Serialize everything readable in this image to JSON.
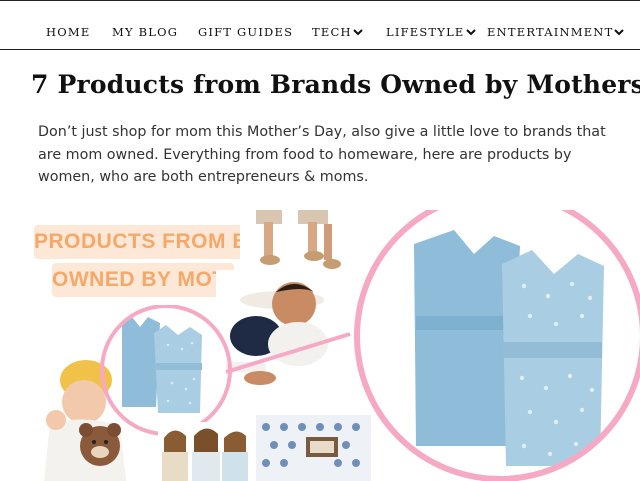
{
  "nav": {
    "items": [
      {
        "label": "HOME",
        "dropdown": false
      },
      {
        "label": "MY BLOG",
        "dropdown": false
      },
      {
        "label": "GIFT GUIDES",
        "dropdown": false
      },
      {
        "label": "TECH",
        "dropdown": true
      },
      {
        "label": "LIFESTYLE",
        "dropdown": true
      },
      {
        "label": "ENTERTAINMENT",
        "dropdown": true
      }
    ]
  },
  "article": {
    "title": "7 Products from Brands Owned by Mothers",
    "intro": "Don’t just shop for mom this Mother’s Day, also give a little love to brands that are mom owned. Everything from food to homeware, here are products by women, who are both entrepreneurs & moms."
  },
  "hero": {
    "banner_line1": "PRODUCTS FROM BRANDS",
    "banner_line2": "OWNED BY MOTHERS"
  },
  "colors": {
    "accent_pink": "#f5a9c4",
    "banner_text": "#f4a96a",
    "banner_bg": "#fde7d6",
    "garment_blue": "#8fbcd8"
  }
}
